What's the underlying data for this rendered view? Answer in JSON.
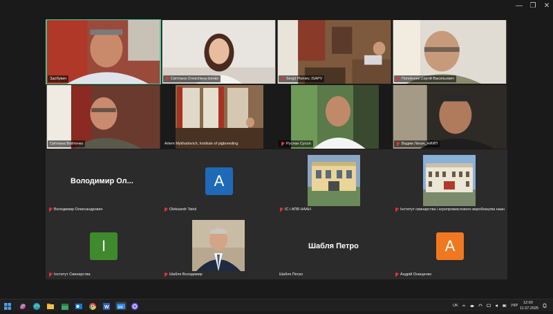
{
  "window": {
    "controls": {
      "minimize": "—",
      "maximize": "❐",
      "close": "✕"
    }
  },
  "participants": [
    {
      "name": "Здобувач",
      "muted": false,
      "active": true
    },
    {
      "name": "Світлана Олексіївна Ісенко",
      "muted": true
    },
    {
      "name": "Sergii Ploniev, ISAPV",
      "muted": true
    },
    {
      "name": "Поплінник Сергій Васильович",
      "muted": true
    },
    {
      "name": "Світлана Войтенко",
      "muted": false
    },
    {
      "name": "Artem Mykhailovich, Institute of pigbreeding",
      "muted": false
    },
    {
      "name": "Руслан Сусол",
      "muted": true
    },
    {
      "name": "Вадим Лихач_НИИП",
      "muted": true
    },
    {
      "name": "Володимир Олександрович",
      "muted": true,
      "display_name": "Володимир Ол..."
    },
    {
      "name": "Oleksandr Tatsii",
      "muted": true,
      "avatar_letter": "A",
      "avatar_color": "#1f6ab7"
    },
    {
      "name": "ІС і АПВ НААН",
      "muted": true
    },
    {
      "name": "Інститут свинарства і агропромислового виробництва наан",
      "muted": true
    },
    {
      "name": "Інститут Свинарства",
      "muted": true,
      "avatar_letter": "I",
      "avatar_color": "#3f8a2c"
    },
    {
      "name": "Шабля Володимир",
      "muted": true
    },
    {
      "name": "Шабля Петро",
      "muted": false,
      "display_name": "Шабля Петро"
    },
    {
      "name": "Андрій Онищенко",
      "muted": true,
      "avatar_letter": "A",
      "avatar_color": "#f07820"
    }
  ],
  "taskbar": {
    "icons": [
      "windows-start",
      "copilot",
      "edge",
      "file-explorer",
      "calendar",
      "outlook",
      "chrome",
      "word",
      "zoom",
      "viber"
    ],
    "tray": {
      "lang_region": "UK",
      "input_lang": "УКР",
      "time": "12:00",
      "date": "11.07.2025"
    }
  }
}
